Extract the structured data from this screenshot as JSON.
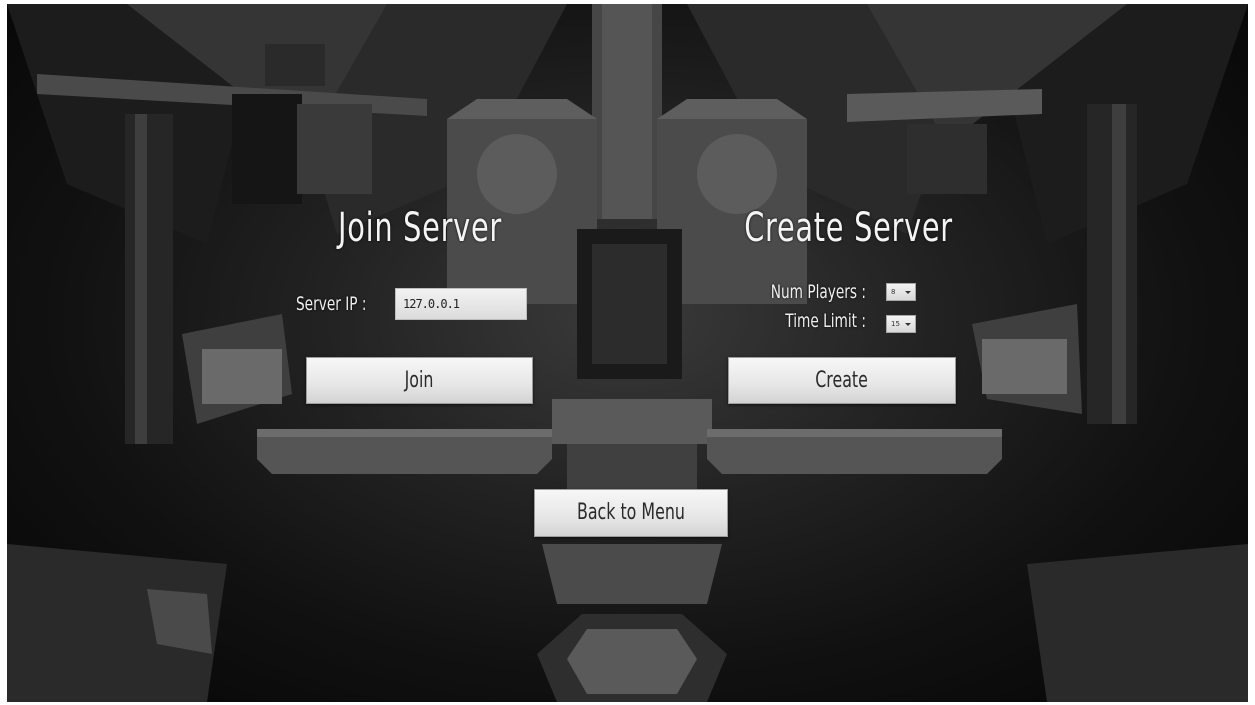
{
  "join": {
    "title": "Join Server",
    "ip_label": "Server IP :",
    "ip_value": "127.0.0.1",
    "join_label": "Join"
  },
  "create": {
    "title": "Create Server",
    "players_label": "Num Players :",
    "players_value": "8",
    "time_label": "Time Limit :",
    "time_value": "15",
    "create_label": "Create"
  },
  "back_label": "Back to Menu"
}
